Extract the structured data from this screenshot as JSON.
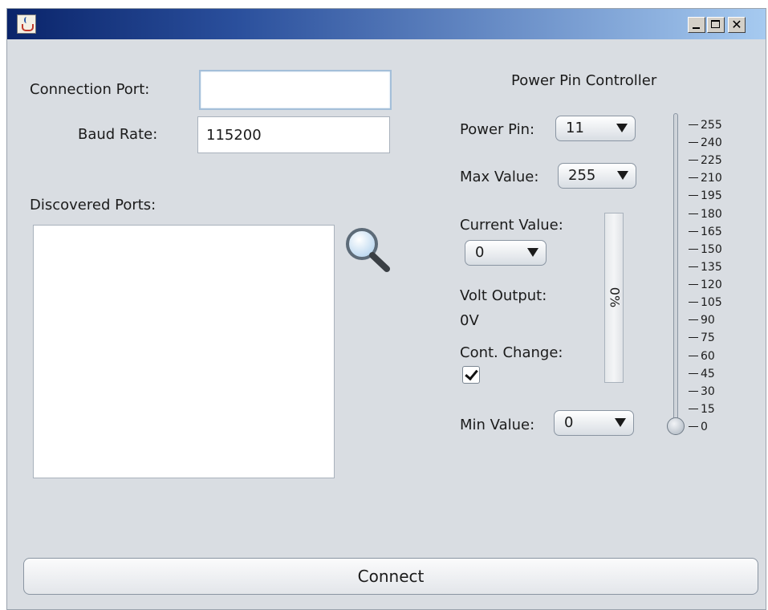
{
  "window": {
    "icon": "java-cup-icon",
    "controls": {
      "minimize": "minimize-icon",
      "maximize": "maximize-icon",
      "close_glyph": "✕"
    }
  },
  "connection": {
    "port_label": "Connection Port:",
    "port_value": "",
    "baud_label": "Baud Rate:",
    "baud_value": "115200"
  },
  "discovered": {
    "label": "Discovered Ports:",
    "items": [],
    "search_icon": "magnifier-icon"
  },
  "power": {
    "title": "Power Pin Controller",
    "pin_label": "Power Pin:",
    "pin_value": "11",
    "max_label": "Max Value:",
    "max_value": "255",
    "current_label": "Current Value:",
    "current_value": "0",
    "volt_label": "Volt Output:",
    "volt_value": "0V",
    "cont_label": "Cont. Change:",
    "cont_checked": true,
    "min_label": "Min Value:",
    "min_value": "0",
    "progress_text": "0%",
    "progress_fraction": 0,
    "slider": {
      "min": 0,
      "max": 255,
      "value": 0,
      "tick_labels": [
        "255",
        "240",
        "225",
        "210",
        "195",
        "180",
        "165",
        "150",
        "135",
        "120",
        "105",
        "90",
        "75",
        "60",
        "45",
        "30",
        "15",
        "0"
      ]
    }
  },
  "connect_label": "Connect",
  "colors": {
    "title_gradient_start": "#0a246a",
    "title_gradient_end": "#a6caf0",
    "panel_bg": "#d9dde2"
  }
}
